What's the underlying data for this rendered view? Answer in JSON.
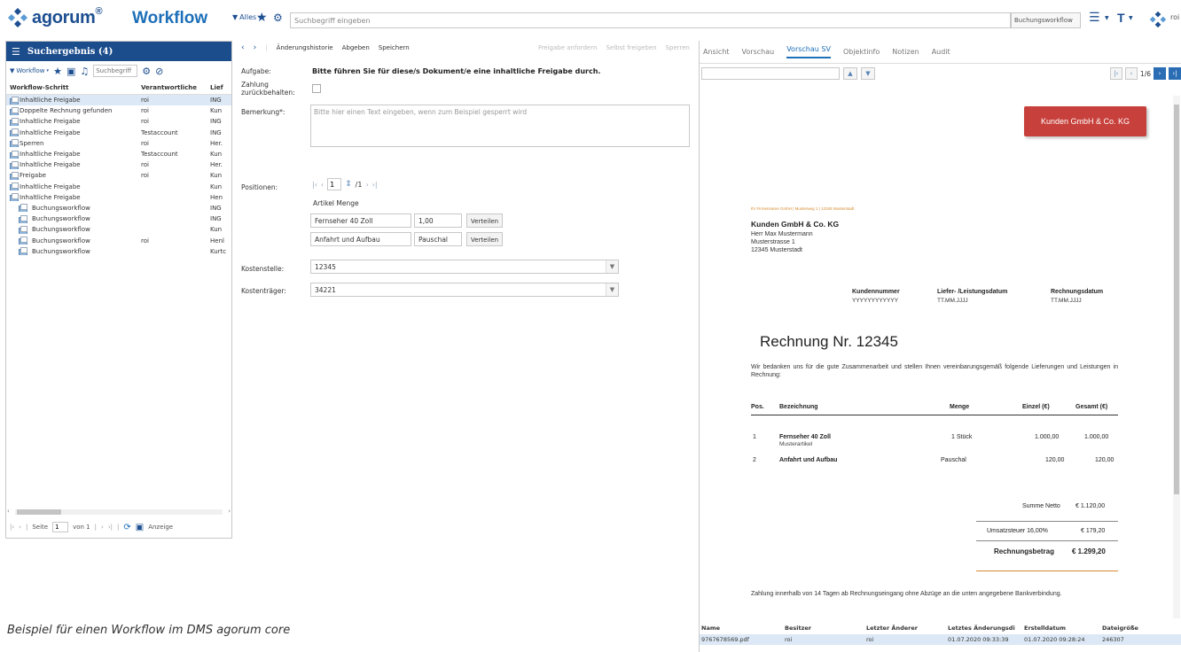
{
  "topbar": {
    "logo_text": "agorum",
    "logo_reg": "®",
    "app_title": "Workflow",
    "filter_label": "Alles",
    "search_placeholder": "Suchbegriff eingeben",
    "workflow_select": "Buchungsworkflow",
    "user": "roi"
  },
  "left": {
    "title": "Suchergebnis (4)",
    "filter_label": "Workflow",
    "search_placeholder": "Suchbegriff",
    "columns": [
      "Workflow-Schritt",
      "Verantwortliche",
      "Lief"
    ],
    "rows": [
      {
        "step": "Inhaltliche Freigabe",
        "resp": "roi",
        "lief": "ING",
        "sel": true,
        "indent": false
      },
      {
        "step": "Doppelte Rechnung gefunden",
        "resp": "roi",
        "lief": "Kun",
        "sel": false,
        "indent": false
      },
      {
        "step": "Inhaltliche Freigabe",
        "resp": "roi",
        "lief": "ING",
        "sel": false,
        "indent": false
      },
      {
        "step": "Inhaltliche Freigabe",
        "resp": "Testaccount",
        "lief": "ING",
        "sel": false,
        "indent": false
      },
      {
        "step": "Sperren",
        "resp": "roi",
        "lief": "Her.",
        "sel": false,
        "indent": false
      },
      {
        "step": "Inhaltliche Freigabe",
        "resp": "Testaccount",
        "lief": "Kun",
        "sel": false,
        "indent": false
      },
      {
        "step": "Inhaltliche Freigabe",
        "resp": "roi",
        "lief": "Her.",
        "sel": false,
        "indent": false
      },
      {
        "step": "Freigabe",
        "resp": "roi",
        "lief": "Kun",
        "sel": false,
        "indent": false
      },
      {
        "step": "Inhaltliche Freigabe",
        "resp": "",
        "lief": "Kun",
        "sel": false,
        "indent": false
      },
      {
        "step": "Inhaltliche Freigabe",
        "resp": "",
        "lief": "Hen",
        "sel": false,
        "indent": false
      },
      {
        "step": "Buchungsworkflow",
        "resp": "",
        "lief": "ING",
        "sel": false,
        "indent": true
      },
      {
        "step": "Buchungsworkflow",
        "resp": "",
        "lief": "ING",
        "sel": false,
        "indent": true
      },
      {
        "step": "Buchungsworkflow",
        "resp": "",
        "lief": "Kun",
        "sel": false,
        "indent": true
      },
      {
        "step": "Buchungsworkflow",
        "resp": "roi",
        "lief": "Henl",
        "sel": false,
        "indent": true
      },
      {
        "step": "Buchungsworkflow",
        "resp": "",
        "lief": "Kurtc",
        "sel": false,
        "indent": true
      }
    ],
    "pager": {
      "page_label": "Seite",
      "page_value": "1",
      "of_label": "von 1",
      "display_label": "Anzeige"
    }
  },
  "caption": "Beispiel für einen Workflow im DMS agorum core",
  "middle": {
    "toolbar": {
      "history": "Änderungshistorie",
      "submit": "Abgeben",
      "save": "Speichern",
      "request_approval": "Freigabe anfordern",
      "self_approve": "Selbst freigeben",
      "lock": "Sperren"
    },
    "task_label": "Aufgabe:",
    "task_value": "Bitte führen Sie für diese/s Dokument/e eine inhaltliche Freigabe durch.",
    "payment_label_1": "Zahlung",
    "payment_label_2": "zurückbehalten:",
    "remark_label": "Bemerkung*:",
    "remark_placeholder": "Bitte hier einen Text eingeben, wenn zum Beispiel gesperrt wird",
    "positions_label": "Positionen:",
    "positions_page": "1",
    "positions_total": "/1",
    "article_header": "Artikel Menge",
    "items": [
      {
        "article": "Fernseher 40 Zoll",
        "qty": "1,00",
        "button": "Verteilen"
      },
      {
        "article": "Anfahrt und Aufbau",
        "qty": "Pauschal",
        "button": "Verteilen"
      }
    ],
    "cost_center_label": "Kostenstelle:",
    "cost_center_value": "12345",
    "cost_unit_label": "Kostenträger:",
    "cost_unit_value": "34221"
  },
  "right": {
    "tabs": [
      "Ansicht",
      "Vorschau",
      "Vorschau SV",
      "Objektinfo",
      "Notizen",
      "Audit"
    ],
    "active_tab": "Vorschau SV",
    "page_indicator": "1/6",
    "invoice": {
      "customer_box": "Kunden GmbH & Co. KG",
      "sender_line": "Ihr Firmenname GmbH | Musterweg 1 | 12345 Musterstadt",
      "addr_name": "Kunden GmbH & Co. KG",
      "addr_lines": [
        "Herr Max Mustermann",
        "Musterstrasse 1",
        "12345 Musterstadt"
      ],
      "meta": [
        {
          "label": "Kundennummer",
          "value": "YYYYYYYYYYYY"
        },
        {
          "label": "Liefer- /Leistungsdatum",
          "value": "TT.MM.JJJJ"
        },
        {
          "label": "Rechnungsdatum",
          "value": "TT.MM.JJJJ"
        }
      ],
      "title": "Rechnung Nr. 12345",
      "intro": "Wir bedanken uns für die gute Zusammenarbeit und stellen Ihnen vereinbarungsgemäß folgende Lieferungen und Leistungen in Rechnung:",
      "table_headers": [
        "Pos.",
        "Bezeichnung",
        "Menge",
        "Einzel (€)",
        "Gesamt (€)"
      ],
      "lines": [
        {
          "pos": "1",
          "name": "Fernseher 40 Zoll",
          "sub": "Musterartikel",
          "qty": "1 Stück",
          "unit": "1.000,00",
          "total": "1.000,00"
        },
        {
          "pos": "2",
          "name": "Anfahrt und Aufbau",
          "sub": "",
          "qty": "Pauschal",
          "unit": "120,00",
          "total": "120,00"
        }
      ],
      "net_label": "Summe Netto",
      "net_value": "€ 1.120,00",
      "vat_label": "Umsatzsteuer 16,00%",
      "vat_value": "€ 179,20",
      "gross_label": "Rechnungsbetrag",
      "gross_value": "€ 1.299,20",
      "footer": "Zahlung innerhalb von 14 Tagen ab Rechnungseingang ohne Abzüge an die unten angegebene Bankverbindung."
    },
    "table": {
      "headers": [
        "Name",
        "Besitzer",
        "Letzter Änderer",
        "Letztes Änderungsdi",
        "Erstelldatum",
        "Dateigröße"
      ],
      "row": [
        "9767678569.pdf",
        "roi",
        "roi",
        "01.07.2020 09:33:39",
        "01.07.2020 09:28:24",
        "246307"
      ]
    }
  }
}
